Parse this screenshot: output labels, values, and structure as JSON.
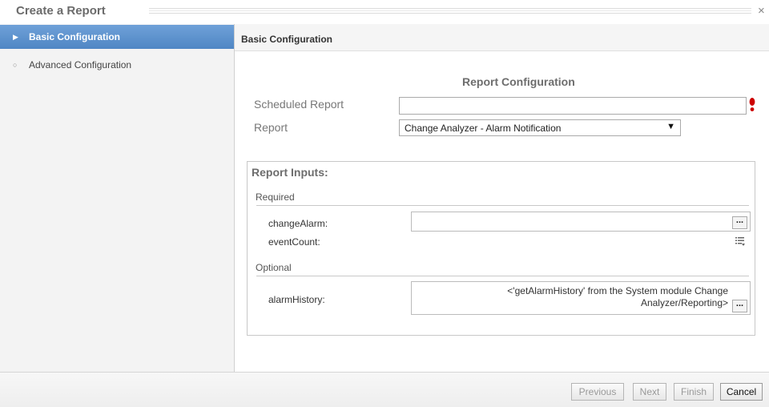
{
  "dialog": {
    "title": "Create a Report",
    "close_icon": "close-icon"
  },
  "sidebar": {
    "items": [
      {
        "label": "Basic Configuration",
        "active": true,
        "icon": "triangle-right-icon"
      },
      {
        "label": "Advanced Configuration",
        "active": false,
        "icon": "circle-bullet-icon"
      }
    ]
  },
  "main": {
    "header": "Basic Configuration",
    "section_title": "Report Configuration",
    "scheduled_report": {
      "label": "Scheduled Report",
      "value": ""
    },
    "report": {
      "label": "Report",
      "selected": "Change Analyzer - Alarm Notification"
    },
    "inputs": {
      "title": "Report Inputs:",
      "required_label": "Required",
      "optional_label": "Optional",
      "change_alarm": {
        "label": "changeAlarm:",
        "value": "",
        "browse": "..."
      },
      "event_count": {
        "label": "eventCount:",
        "icon": "list-dropdown-icon"
      },
      "alarm_history": {
        "label": "alarmHistory:",
        "value": "<'getAlarmHistory' from the System module Change Analyzer/Reporting>",
        "browse": "..."
      }
    }
  },
  "footer": {
    "previous": "Previous",
    "next": "Next",
    "finish": "Finish",
    "cancel": "Cancel"
  },
  "colors": {
    "active_item": "#5b8fcb",
    "required": "#cc0000",
    "sidebar_bg": "#f3f3f3"
  }
}
